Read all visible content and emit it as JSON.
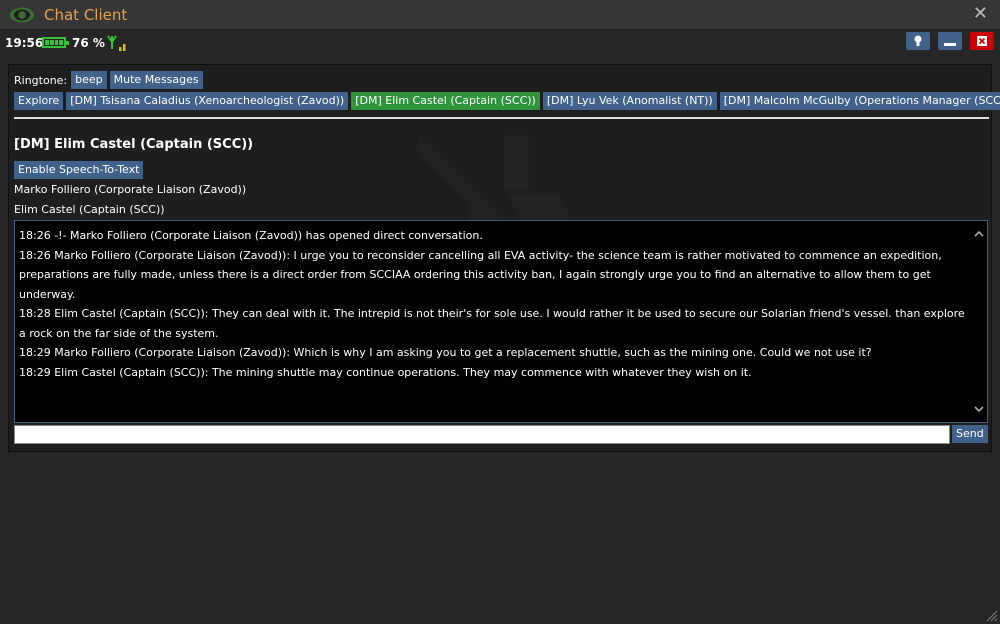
{
  "window": {
    "title": "Chat Client",
    "close_glyph": "✕"
  },
  "status": {
    "time": "19:56",
    "charge": "76 %",
    "icons": [
      "battery-icon",
      "signal-icon"
    ]
  },
  "header_buttons": [
    {
      "name": "light-icon",
      "color": "#40628a"
    },
    {
      "name": "minimize-icon",
      "color": "#40628a"
    },
    {
      "name": "close-icon",
      "color": "#cc0000"
    }
  ],
  "chat": {
    "ringtone_label": "Ringtone:",
    "ringtone_value": "beep",
    "mute_label": "Mute Messages",
    "tabs": [
      {
        "label": "Explore",
        "selected": false
      },
      {
        "label": "[DM] Tsisana Caladius (Xenoarcheologist (Zavod))",
        "selected": false
      },
      {
        "label": "[DM] Elim Castel (Captain (SCC))",
        "selected": true
      },
      {
        "label": "[DM] Lyu Vek (Anomalist (NT))",
        "selected": false
      },
      {
        "label": "[DM] Malcolm McGulby (Operations Manager (SCC))",
        "selected": false
      }
    ],
    "conversation_title": "[DM] Elim Castel (Captain (SCC))",
    "speech_button": "Enable Speech-To-Text",
    "participants": [
      "Marko Folliero (Corporate Liaison (Zavod))",
      "Elim Castel (Captain (SCC))"
    ],
    "messages": [
      "18:26 -!- Marko Folliero (Corporate Liaison (Zavod)) has opened direct conversation.",
      "18:26 Marko Folliero (Corporate Liaison (Zavod)): I urge you to reconsider cancelling all EVA activity- the science team is rather motivated to commence an expedition, preparations are fully made, unless there is a direct order from SCCIAA ordering this activity ban, I again strongly urge you to find an alternative to allow them to get underway.",
      "18:28 Elim Castel (Captain (SCC)): They can deal with it. The intrepid is not their's for sole use. I would rather it be used to secure our Solarian friend's vessel. than explore a rock on the far side of the system.",
      "18:29 Marko Folliero (Corporate Liaison (Zavod)): Which is why I am asking you to get a replacement shuttle, such as the mining one. Could we not use it?",
      "18:29 Elim Castel (Captain (SCC)): The mining shuttle may continue operations. They may commence with whatever they wish on it."
    ],
    "input_value": "",
    "send_label": "Send"
  },
  "colors": {
    "accent": "#40628a",
    "selected_tab": "#2f943c",
    "title": "#e6a24d",
    "battery": "#34c134",
    "signal": "#d7c400"
  }
}
